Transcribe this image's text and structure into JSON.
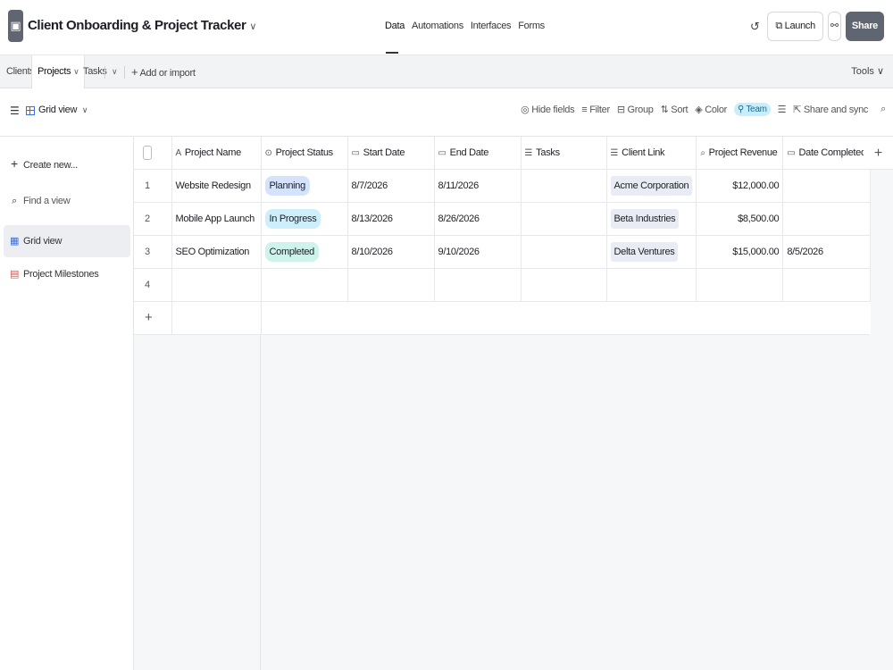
{
  "header": {
    "title": "Client Onboarding & Project Tracker",
    "title_chevron": "∨",
    "nav": [
      "Data",
      "Automations",
      "Interfaces",
      "Forms"
    ],
    "launch_label": "Launch",
    "share_label": "Share"
  },
  "tabs": {
    "items": [
      "Clients",
      "Projects",
      "Tasks"
    ],
    "projects_chevron": "∨",
    "more_chevron": "∨",
    "add_label": "Add or import",
    "tools_label": "Tools ∨"
  },
  "viewbar": {
    "view_name": "Grid view",
    "view_chevron": "∨",
    "hide_fields": "Hide fields",
    "filter": "Filter",
    "group": "Group",
    "sort": "Sort",
    "color": "Color",
    "team": "Team",
    "share_sync": "Share and sync"
  },
  "sidebar": {
    "create_new": "Create new...",
    "find_view": "Find a view",
    "views": [
      "Grid view",
      "Project Milestones"
    ]
  },
  "table": {
    "columns": [
      "Project Name",
      "Project Status",
      "Start Date",
      "End Date",
      "Tasks",
      "Client Link",
      "Project Revenue",
      "Date Completed"
    ],
    "rows": [
      {
        "num": "1",
        "name": "Website Redesign",
        "status": "Planning",
        "status_color": "#d4e3fb",
        "start": "8/7/2026",
        "end": "8/11/2026",
        "tasks": "",
        "client": "Acme Corporation",
        "revenue": "$12,000.00",
        "completed": ""
      },
      {
        "num": "2",
        "name": "Mobile App Launch",
        "status": "In Progress",
        "status_color": "#cdeefb",
        "start": "8/13/2026",
        "end": "8/26/2026",
        "tasks": "",
        "client": "Beta Industries",
        "revenue": "$8,500.00",
        "completed": ""
      },
      {
        "num": "3",
        "name": "SEO Optimization",
        "status": "Completed",
        "status_color": "#cdf3ea",
        "start": "8/10/2026",
        "end": "9/10/2026",
        "tasks": "",
        "client": "Delta Ventures",
        "revenue": "$15,000.00",
        "completed": "8/5/2026"
      }
    ],
    "empty_row_num": "4",
    "add_row": "+",
    "add_col": "+"
  }
}
